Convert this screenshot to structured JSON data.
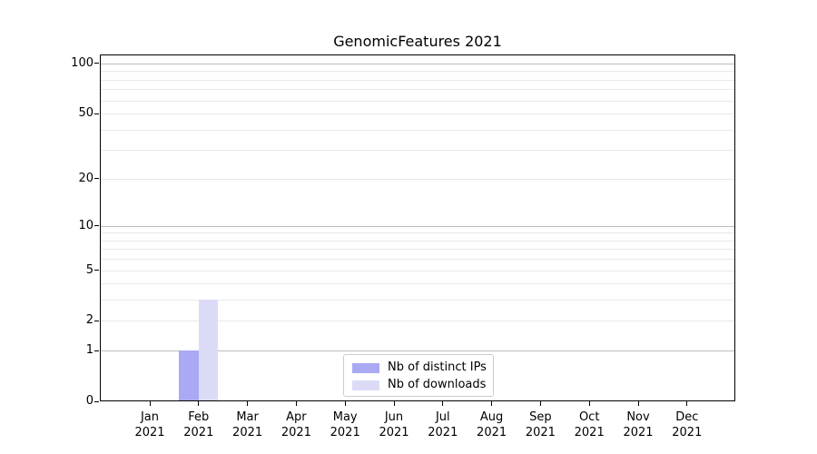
{
  "figure": {
    "background": "#ffffff"
  },
  "chart_data": {
    "type": "bar",
    "title": "GenomicFeatures 2021",
    "categories": [
      "Jan 2021",
      "Feb 2021",
      "Mar 2021",
      "Apr 2021",
      "May 2021",
      "Jun 2021",
      "Jul 2021",
      "Aug 2021",
      "Sep 2021",
      "Oct 2021",
      "Nov 2021",
      "Dec 2021"
    ],
    "series": [
      {
        "name": "Nb of distinct IPs",
        "color": "#a9a9f4",
        "values": [
          0,
          1,
          0,
          0,
          0,
          0,
          0,
          0,
          0,
          0,
          0,
          0
        ]
      },
      {
        "name": "Nb of downloads",
        "color": "#dbdbf8",
        "values": [
          0,
          3,
          0,
          0,
          0,
          0,
          0,
          0,
          0,
          0,
          0,
          0
        ]
      }
    ],
    "xlabel": "",
    "ylabel": "",
    "y_axis": {
      "scale": "log10(value+1)",
      "tick_values": [
        100,
        50,
        20,
        10,
        5,
        2,
        1,
        0
      ],
      "major_gridlines": [
        1,
        10,
        100
      ],
      "minor_gridlines": [
        2,
        3,
        4,
        5,
        6,
        7,
        8,
        9,
        20,
        30,
        40,
        50,
        60,
        70,
        80,
        90
      ],
      "range": [
        0,
        113
      ]
    },
    "legend": {
      "position": "lower center",
      "entries": [
        "Nb of distinct IPs",
        "Nb of downloads"
      ]
    },
    "grid": "horizontal",
    "colors": {
      "major_grid": "#bdbdbd",
      "minor_grid": "#e9e9e9",
      "spine": "#000000",
      "text": "#000000"
    }
  }
}
